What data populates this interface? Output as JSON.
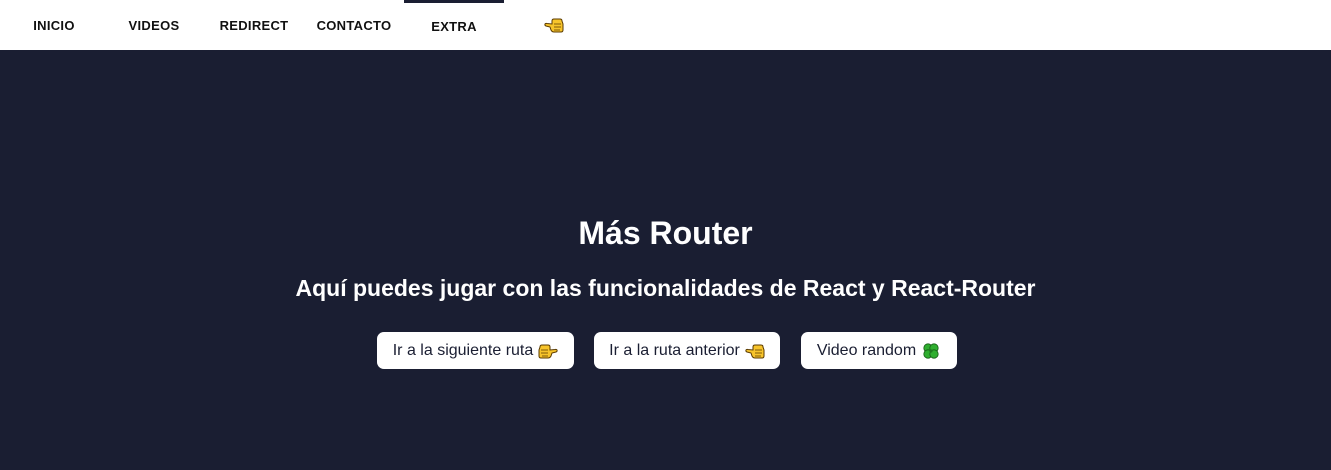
{
  "nav": {
    "items": [
      {
        "label": "INICIO"
      },
      {
        "label": "VIDEOS"
      },
      {
        "label": "REDIRECT"
      },
      {
        "label": "CONTACTO"
      },
      {
        "label": "EXTRA"
      }
    ],
    "active_index": 4,
    "trailing_icon": "backhand-index-pointing-left-icon"
  },
  "main": {
    "title": "Más Router",
    "subtitle": "Aquí puedes jugar con las funcionalidades de React y React-Router",
    "buttons": [
      {
        "label": "Ir a la siguiente ruta",
        "icon": "backhand-index-pointing-right-icon"
      },
      {
        "label": "Ir a la ruta anterior",
        "icon": "backhand-index-pointing-left-icon"
      },
      {
        "label": "Video random",
        "icon": "four-leaf-clover-icon"
      }
    ]
  },
  "colors": {
    "background": "#1a1e32",
    "nav_background": "#ffffff",
    "nav_text": "#111111",
    "button_background": "#ffffff",
    "text_light": "#ffffff",
    "hand": "#f7c42b",
    "clover": "#2fae2f"
  }
}
